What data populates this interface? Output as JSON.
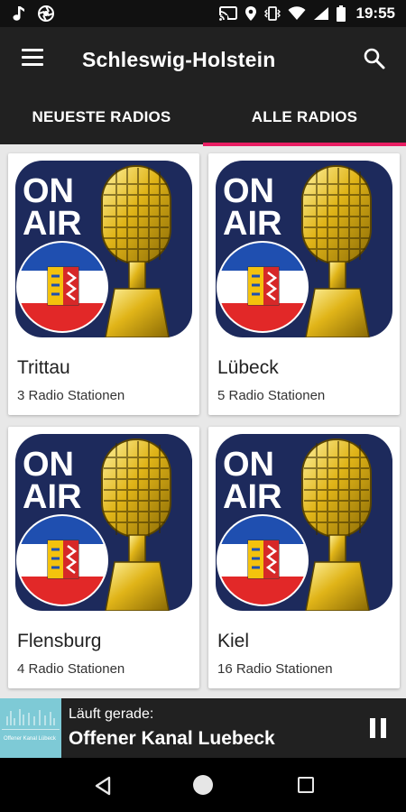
{
  "status_bar": {
    "time": "19:55",
    "left_icons": [
      "music-note-icon",
      "camera-aperture-icon"
    ],
    "right_icons": [
      "cast-icon",
      "location-icon",
      "vibrate-icon",
      "wifi-icon",
      "cell-signal-icon",
      "battery-icon"
    ]
  },
  "app_bar": {
    "title": "Schleswig-Holstein",
    "menu_icon": "menu-icon",
    "search_icon": "search-icon"
  },
  "tabs": [
    {
      "label": "NEUESTE RADIOS",
      "active": false
    },
    {
      "label": "ALLE RADIOS",
      "active": true
    }
  ],
  "accent_color": "#e91e63",
  "stations": [
    {
      "name": "Trittau",
      "count": "3 Radio Stationen",
      "art_text": [
        "ON",
        "AIR"
      ]
    },
    {
      "name": "Lübeck",
      "count": "5 Radio Stationen",
      "art_text": [
        "ON",
        "AIR"
      ]
    },
    {
      "name": "Flensburg",
      "count": "4 Radio Stationen",
      "art_text": [
        "ON",
        "AIR"
      ]
    },
    {
      "name": "Kiel",
      "count": "16 Radio Stationen",
      "art_text": [
        "ON",
        "AIR"
      ]
    }
  ],
  "player": {
    "caption": "Läuft gerade:",
    "title": "Offener Kanal Luebeck",
    "thumb_text": "Offener Kanal Lübeck",
    "state_icon": "pause-icon"
  },
  "nav_bar": {
    "icons": [
      "back-icon",
      "home-icon",
      "recents-icon"
    ]
  }
}
